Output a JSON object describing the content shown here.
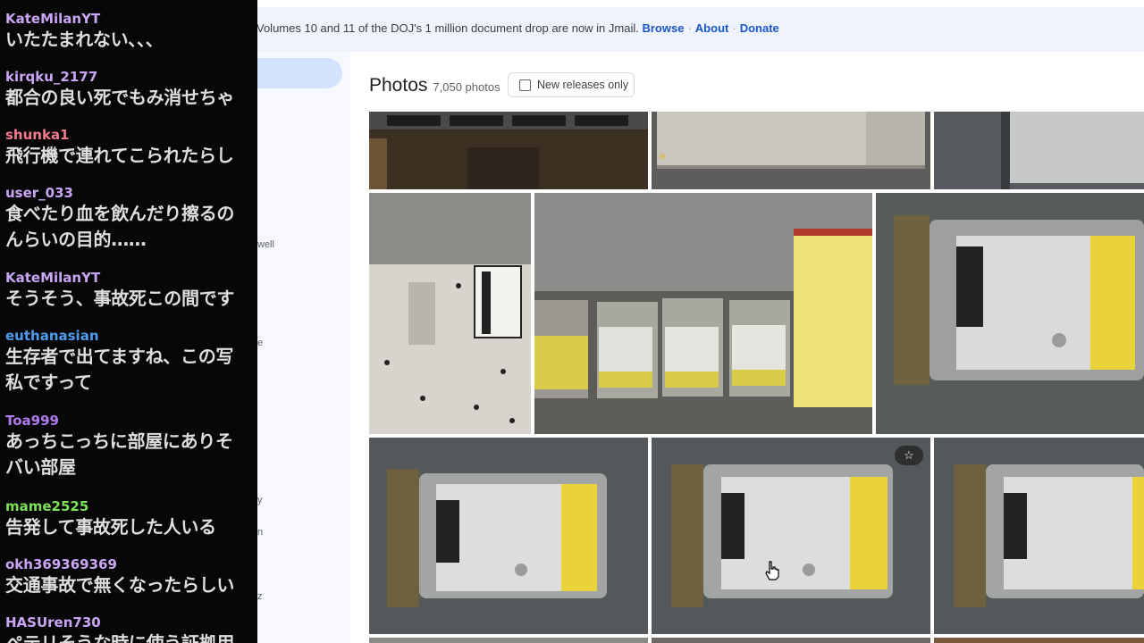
{
  "banner": {
    "text": "Volumes 10 and 11 of the DOJ's 1 million document drop are now in Jmail.",
    "links": [
      "Browse",
      "About",
      "Donate"
    ],
    "separator": "·"
  },
  "sidebar_fragments": [
    "well",
    "e",
    "y",
    "n",
    "z"
  ],
  "photos": {
    "title": "Photos",
    "count": "7,050 photos",
    "filter_label": "New releases only",
    "filter_checked": false,
    "star_glyph": "☆"
  },
  "chat": {
    "messages": [
      {
        "user": "KateMilanYT",
        "color": "#c9a6f5",
        "text": "いたたまれない、、、"
      },
      {
        "user": "kirqku_2177",
        "color": "#c9a6f5",
        "text": "都合の良い死でもみ消せちゃ"
      },
      {
        "user": "shunka1",
        "color": "#f07a8c",
        "text": "飛行機で連れてこられたらし"
      },
      {
        "user": "user_033",
        "color": "#c9a6f5",
        "text": "食べたり血を飲んだり擦るの\nんらいの目的……"
      },
      {
        "user": "KateMilanYT",
        "color": "#c9a6f5",
        "text": "そうそう、事故死この間です"
      },
      {
        "user": "euthanasian",
        "color": "#4d9cf0",
        "text": "生存者で出てますね、この写\n私ですって"
      },
      {
        "user": "Toa999",
        "color": "#b07af0",
        "text": "あっちこっちに部屋にありそ\nバい部屋"
      },
      {
        "user": "mame2525",
        "color": "#7ee05a",
        "text": "告発して事故死した人いる"
      },
      {
        "user": "okh369369369",
        "color": "#c9a6f5",
        "text": "交通事故で無くなったらしい"
      },
      {
        "user": "HASUren730",
        "color": "#c9a6f5",
        "text": "ペテリそうな時に使う証拠用"
      }
    ]
  },
  "colors": {
    "banner_bg": "#eef3fd",
    "link": "#1a56c8",
    "sidebar_bg": "#f6f8fc",
    "active_pill": "#d3e3fd",
    "chat_bg": "#070707"
  },
  "icons": [
    "checkbox-icon",
    "star-icon",
    "hand-cursor-icon"
  ]
}
